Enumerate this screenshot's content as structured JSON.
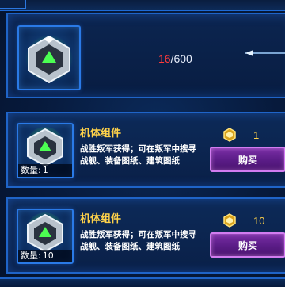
{
  "header": {
    "progress_current": "16",
    "progress_total": "/600",
    "progress_fraction": 0.0267
  },
  "items": [
    {
      "name": "机体组件",
      "description": "战胜叛军获得；可在叛军中搜寻战舰、装备图纸、建筑图纸",
      "quantity_label": "数量:",
      "quantity": "1",
      "price": "1",
      "buy_label": "购买",
      "icon": "mech-component-icon"
    },
    {
      "name": "机体组件",
      "description": "战胜叛军获得；可在叛军中搜寻战舰、装备图纸、建筑图纸",
      "quantity_label": "数量:",
      "quantity": "10",
      "price": "10",
      "buy_label": "购买",
      "icon": "mech-component-icon"
    }
  ],
  "colors": {
    "frame_blue": "#1f64c8",
    "name_gold": "#ffd24a",
    "progress_red": "#ff3b3b",
    "button_purple": "#6a24a0",
    "item_green_glow": "#5dff5a"
  }
}
